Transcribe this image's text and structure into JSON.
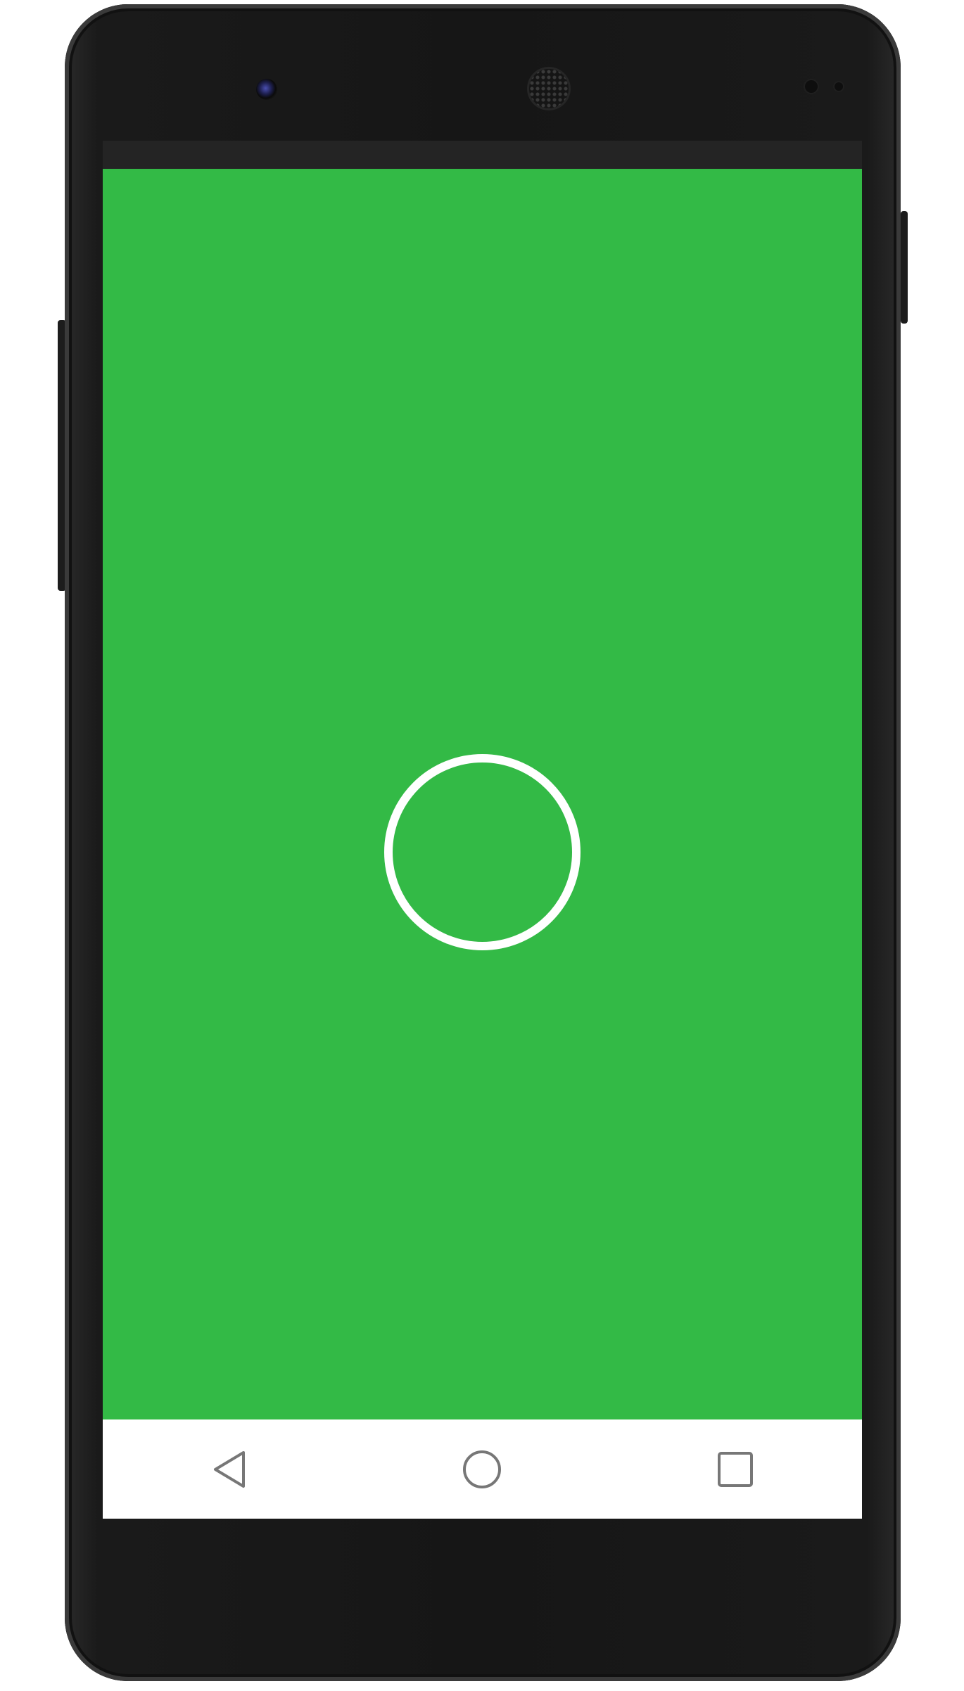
{
  "device": {
    "frame_color": "#161616",
    "screen_bg_color": "#33ba46"
  },
  "status_bar": {
    "color": "#242424"
  },
  "main": {
    "center_control": {
      "icon": "ring-icon",
      "color": "#ffffff"
    }
  },
  "navigation_bar": {
    "background": "#ffffff",
    "buttons": [
      {
        "icon": "back-triangle-icon"
      },
      {
        "icon": "home-circle-icon"
      },
      {
        "icon": "recents-square-icon"
      }
    ]
  }
}
